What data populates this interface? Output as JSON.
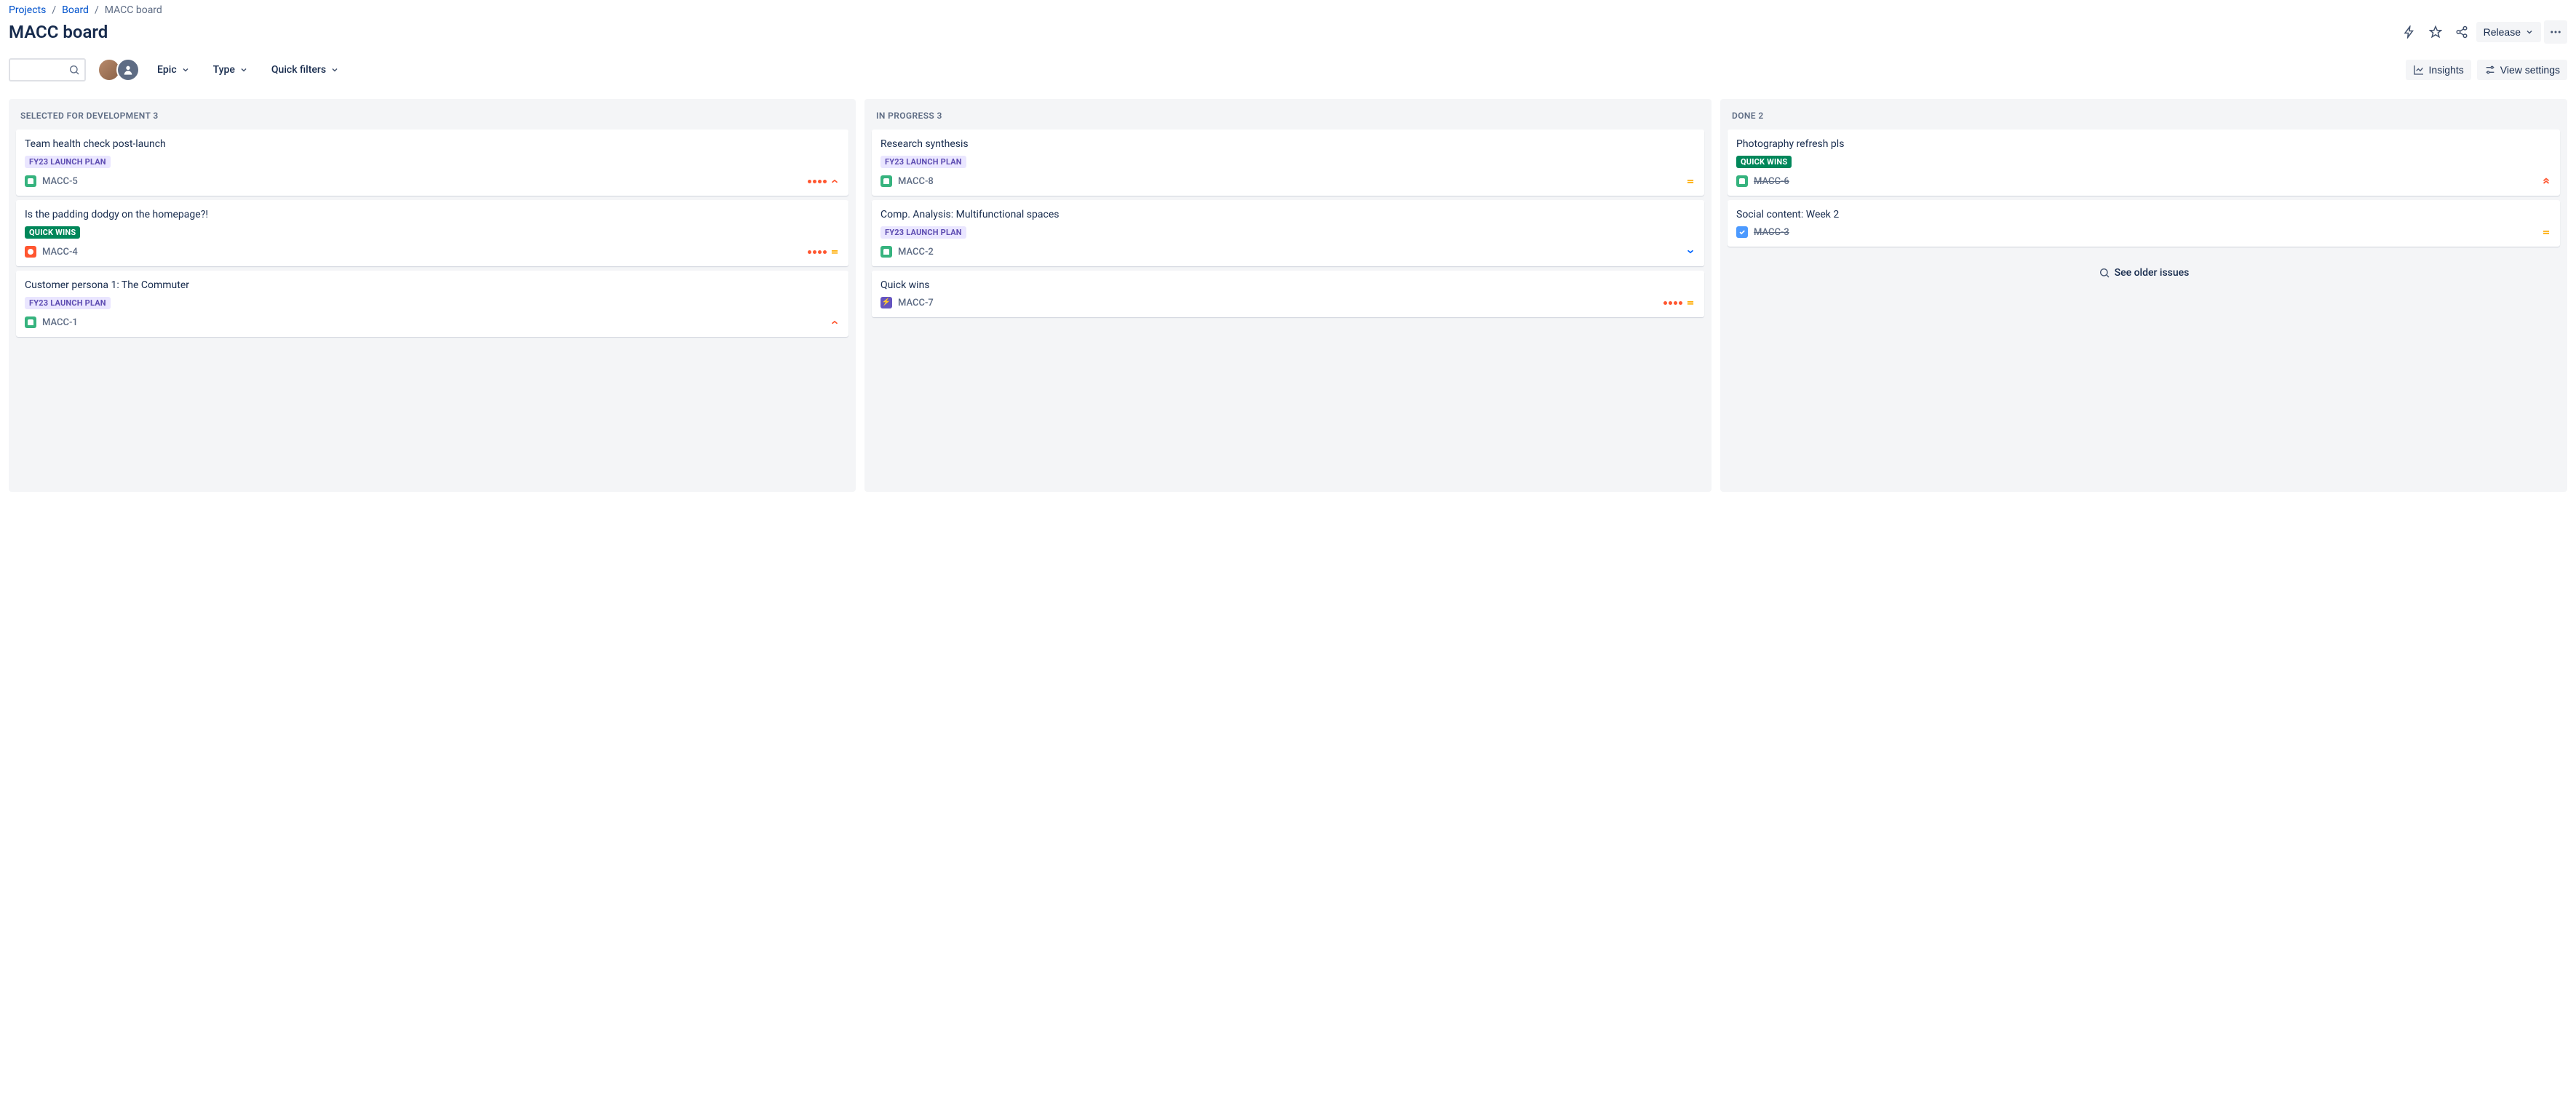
{
  "breadcrumb": {
    "projects": "Projects",
    "board": "Board",
    "current": "MACC board"
  },
  "page_title": "MACC board",
  "header": {
    "release_label": "Release"
  },
  "toolbar": {
    "epic_label": "Epic",
    "type_label": "Type",
    "quick_filters_label": "Quick filters",
    "insights_label": "Insights",
    "view_settings_label": "View settings"
  },
  "labels": {
    "fy23": "FY23 LAUNCH PLAN",
    "quick_wins": "QUICK WINS"
  },
  "columns": [
    {
      "title": "Selected for Development",
      "count": "3",
      "cards": [
        {
          "title": "Team health check post-launch",
          "label": "fy23",
          "type": "story",
          "key": "MACC-5",
          "dots": true,
          "priority": "high",
          "done": false
        },
        {
          "title": "Is the padding dodgy on the homepage?!",
          "label": "quick_wins",
          "type": "bug",
          "key": "MACC-4",
          "dots": true,
          "priority": "medium",
          "done": false
        },
        {
          "title": "Customer persona 1: The Commuter",
          "label": "fy23",
          "type": "story",
          "key": "MACC-1",
          "dots": false,
          "priority": "high",
          "done": false
        }
      ]
    },
    {
      "title": "In Progress",
      "count": "3",
      "cards": [
        {
          "title": "Research synthesis",
          "label": "fy23",
          "type": "story",
          "key": "MACC-8",
          "dots": false,
          "priority": "medium",
          "done": false
        },
        {
          "title": "Comp. Analysis: Multifunctional spaces",
          "label": "fy23",
          "type": "story",
          "key": "MACC-2",
          "dots": false,
          "priority": "low",
          "done": false
        },
        {
          "title": "Quick wins",
          "label": null,
          "type": "epic",
          "key": "MACC-7",
          "dots": true,
          "priority": "medium",
          "done": false
        }
      ]
    },
    {
      "title": "Done",
      "count": "2",
      "older_label": "See older issues",
      "cards": [
        {
          "title": "Photography refresh pls",
          "label": "quick_wins",
          "type": "story",
          "key": "MACC-6",
          "dots": false,
          "priority": "highest",
          "done": true
        },
        {
          "title": "Social content: Week 2",
          "label": null,
          "type": "task",
          "key": "MACC-3",
          "dots": false,
          "priority": "medium",
          "done": true
        }
      ]
    }
  ]
}
